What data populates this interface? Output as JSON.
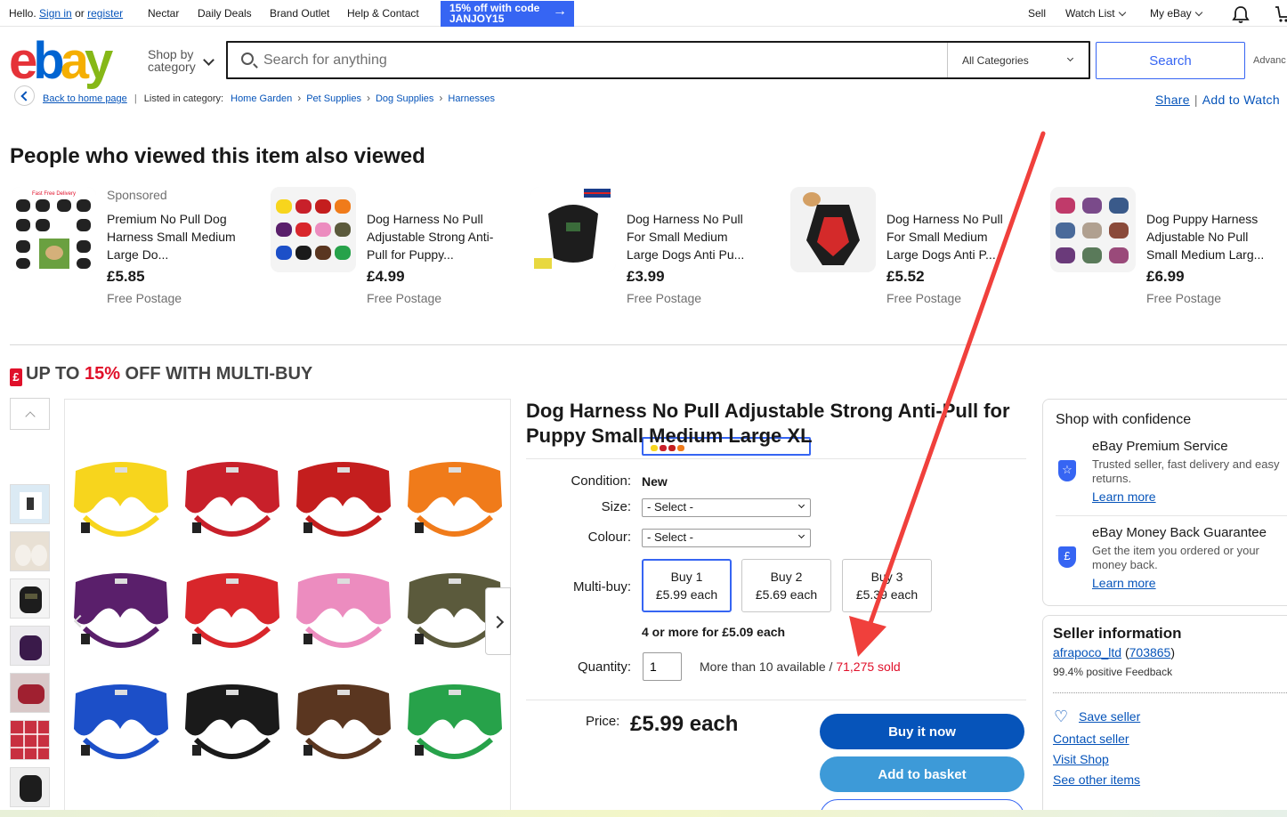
{
  "topnav": {
    "hello": "Hello.",
    "sign_in": "Sign in",
    "or": "or",
    "register": "register",
    "links": [
      "Nectar",
      "Daily Deals",
      "Brand Outlet",
      "Help & Contact"
    ],
    "promo_line1": "15% off with code",
    "promo_line2": "JANJOY15",
    "sell": "Sell",
    "watch_list": "Watch List",
    "my_ebay": "My eBay"
  },
  "header": {
    "shop_by_1": "Shop by",
    "shop_by_2": "category",
    "search_placeholder": "Search for anything",
    "category": "All Categories",
    "search_button": "Search",
    "advanced": "Advanc"
  },
  "breadcrumb": {
    "back": "Back to home page",
    "listed_in": "Listed in category:",
    "items": [
      "Home Garden",
      "Pet Supplies",
      "Dog Supplies",
      "Harnesses"
    ],
    "share": "Share",
    "add_to_watch": "Add to Watch"
  },
  "also_viewed": {
    "heading": "People who viewed this item also viewed",
    "items": [
      {
        "sponsored": "Sponsored",
        "title": "Premium No Pull Dog Harness Small Medium Large Do...",
        "price": "£5.85",
        "postage": "Free Postage"
      },
      {
        "sponsored": "",
        "title": "Dog Harness No Pull Adjustable Strong Anti-Pull for Puppy...",
        "price": "£4.99",
        "postage": "Free Postage"
      },
      {
        "sponsored": "",
        "title": "Dog Harness No Pull For Small Medium Large Dogs Anti Pu...",
        "price": "£3.99",
        "postage": "Free Postage"
      },
      {
        "sponsored": "",
        "title": "Dog Harness No Pull For Small Medium Large Dogs Anti P...",
        "price": "£5.52",
        "postage": "Free Postage"
      },
      {
        "sponsored": "",
        "title": "Dog Puppy Harness Adjustable No Pull Small Medium Larg...",
        "price": "£6.99",
        "postage": "Free Postage"
      }
    ]
  },
  "multibuy_banner": {
    "pre": "UP TO ",
    "pct": "15%",
    "post": " OFF WITH MULTI-BUY"
  },
  "item": {
    "title": "Dog Harness No Pull Adjustable Strong Anti-Pull for Puppy Small Medium Large XL",
    "condition_label": "Condition:",
    "condition": "New",
    "size_label": "Size:",
    "size_value": "- Select -",
    "colour_label": "Colour:",
    "colour_value": "- Select -",
    "multibuy_label": "Multi-buy:",
    "multibuy": [
      {
        "qty": "Buy 1",
        "price": "£5.99 each"
      },
      {
        "qty": "Buy 2",
        "price": "£5.69 each"
      },
      {
        "qty": "Buy 3",
        "price": "£5.39 each"
      }
    ],
    "multibuy_note": "4 or more for £5.09 each",
    "quantity_label": "Quantity:",
    "quantity": "1",
    "available": "More than 10 available / ",
    "sold": "71,275 sold",
    "price_label": "Price:",
    "price": "£5.99 each",
    "buy_now": "Buy it now",
    "add_to_basket": "Add to basket"
  },
  "confidence": {
    "heading": "Shop with confidence",
    "blocks": [
      {
        "title": "eBay Premium Service",
        "desc": "Trusted seller, fast delivery and easy returns.",
        "link": "Learn more"
      },
      {
        "title": "eBay Money Back Guarantee",
        "desc": "Get the item you ordered or your money back.",
        "link": "Learn more"
      }
    ]
  },
  "seller": {
    "heading": "Seller information",
    "name": "afrapoco_ltd",
    "score": "703865",
    "feedback": "99.4% positive Feedback",
    "save": "Save seller",
    "contact": "Contact seller",
    "visit": "Visit Shop",
    "other": "See other items"
  },
  "colors": {
    "accent": "#3665f3",
    "link": "#0654ba",
    "sold_red": "#e0102a",
    "annotation_arrow": "#f0403c"
  },
  "harness_colors": [
    "#f7d51d",
    "#c8202a",
    "#c41e1e",
    "#f07b1a",
    "#5a1f6b",
    "#d8262b",
    "#ec8cbf",
    "#5b5a3c",
    "#1c4fc8",
    "#1a1a1a",
    "#5a3620",
    "#27a24a"
  ]
}
